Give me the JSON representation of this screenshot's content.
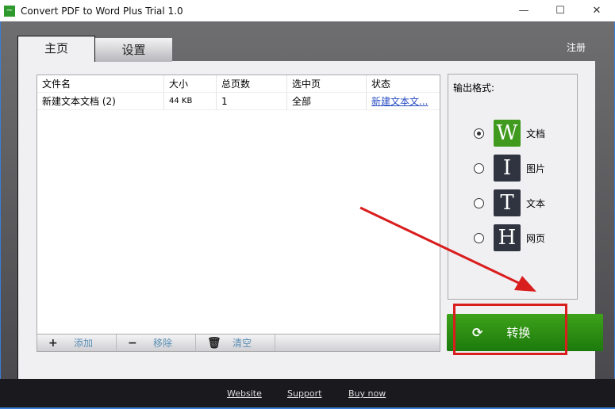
{
  "window": {
    "title": "Convert PDF to Word Plus Trial 1.0",
    "minimize": "—",
    "maximize": "☐",
    "close": "✕"
  },
  "tabs": [
    {
      "label": "主页",
      "active": true
    },
    {
      "label": "设置",
      "active": false
    }
  ],
  "register": "注册",
  "table": {
    "headers": [
      "文件名",
      "大小",
      "总页数",
      "选中页",
      "状态"
    ],
    "rows": [
      [
        "新建文本文档 (2)",
        "44 KB",
        "1",
        "全部",
        "新建文本文..."
      ]
    ]
  },
  "toolbar": {
    "add": "添加",
    "remove": "移除",
    "clear": "清空"
  },
  "output": {
    "label": "输出格式:",
    "options": [
      {
        "letter": "W",
        "label": "文档",
        "selected": true
      },
      {
        "letter": "I",
        "label": "图片",
        "selected": false
      },
      {
        "letter": "T",
        "label": "文本",
        "selected": false
      },
      {
        "letter": "H",
        "label": "网页",
        "selected": false
      }
    ]
  },
  "convert": "转换",
  "footer": {
    "website": "Website",
    "support": "Support",
    "buy": "Buy now"
  },
  "colors": {
    "accent": "#2e9a2e",
    "annotation": "#d91e1e"
  }
}
